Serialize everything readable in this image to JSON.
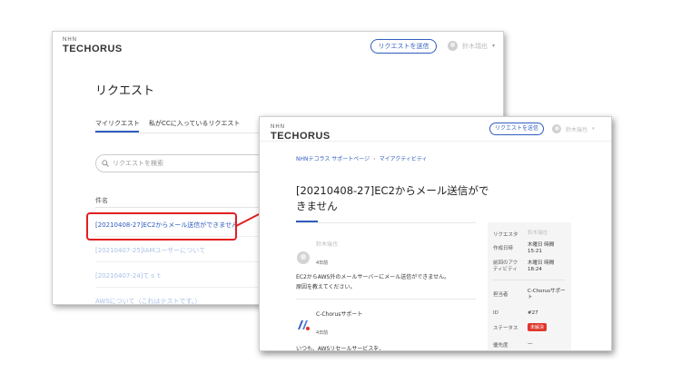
{
  "back": {
    "brand_mark": "NHN",
    "brand_name": "TECHORUS",
    "request_button": "リクエストを送信",
    "user_name": "鈴木瑞也",
    "page_title": "リクエスト",
    "tabs": [
      "マイリクエスト",
      "私がCCに入っているリクエスト"
    ],
    "search_placeholder": "リクエストを検索",
    "column_header": "件名",
    "rows": [
      "[20210408-27]EC2からメール送信ができません",
      "[20210407-25]IAMユーザーについて",
      "[20210407-24]てｓｔ",
      "AWSについて（これはテストです。）"
    ]
  },
  "front": {
    "brand_mark": "NHN",
    "brand_name": "TECHORUS",
    "request_button": "リクエストを送信",
    "user_name": "鈴木瑞也",
    "breadcrumbs": [
      "NHNテコラス サポートページ",
      "マイアクティビティ"
    ],
    "title": "[20210408-27]EC2からメール送信ができません",
    "comment1": {
      "author": "鈴木瑞也",
      "time": "4日前",
      "body_line1": "EC2からAWS外のメールサーバーにメール送信ができません。",
      "body_line2": "原因を教えてください。"
    },
    "comment2": {
      "author": "C-Chorusサポート",
      "time": "4日前",
      "body": "いつも、AWSリセールサービスを、"
    },
    "details": {
      "requester_label": "リクエスタ",
      "requester_value": "鈴木瑞也",
      "created_label": "作成日時",
      "created_value_1": "木曜日 時間",
      "created_value_2": "15:21",
      "last_activity_label_1": "前回のアク",
      "last_activity_label_2": "ティビティ",
      "last_activity_value_1": "木曜日 時間",
      "last_activity_value_2": "18:24",
      "assignee_label": "担当者",
      "assignee_value_1": "C-Chorusサポー",
      "assignee_value_2": "ト",
      "id_label": "ID",
      "id_value": "#27",
      "status_label": "ステータス",
      "status_value": "未解決",
      "priority_label": "優先度",
      "priority_value": "—"
    }
  },
  "colors": {
    "accent": "#2f5dbf",
    "highlight": "#e02020",
    "status": "#e0362c"
  }
}
